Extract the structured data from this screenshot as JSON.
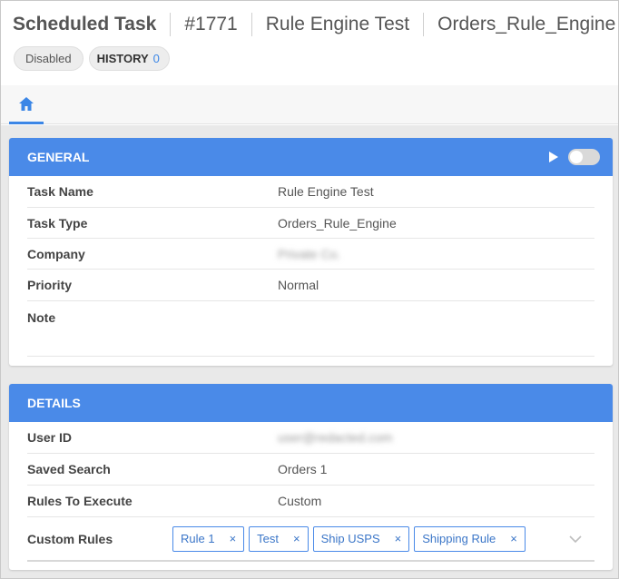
{
  "header": {
    "title": "Scheduled Task",
    "task_id": "#1771",
    "task_name": "Rule Engine Test",
    "task_type": "Orders_Rule_Engine",
    "status_badge": "Disabled",
    "history_label": "HISTORY",
    "history_count": "0"
  },
  "tabs": [
    {
      "icon": "home-icon",
      "active": true
    }
  ],
  "colors": {
    "accent": "#4a8ae8",
    "background": "#e9e9e9"
  },
  "general": {
    "section_title": "GENERAL",
    "fields": [
      {
        "label": "Task Name",
        "value": "Rule Engine Test"
      },
      {
        "label": "Task Type",
        "value": "Orders_Rule_Engine"
      },
      {
        "label": "Company",
        "value": "Private Co."
      },
      {
        "label": "Priority",
        "value": "Normal"
      },
      {
        "label": "Note",
        "value": ""
      }
    ]
  },
  "details": {
    "section_title": "DETAILS",
    "fields": [
      {
        "label": "User ID",
        "value": "user@redacted.com"
      },
      {
        "label": "Saved Search",
        "value": "Orders 1"
      },
      {
        "label": "Rules To Execute",
        "value": "Custom"
      }
    ],
    "custom_rules_label": "Custom Rules",
    "custom_rules": [
      "Rule 1",
      "Test",
      "Ship USPS",
      "Shipping Rule"
    ]
  }
}
